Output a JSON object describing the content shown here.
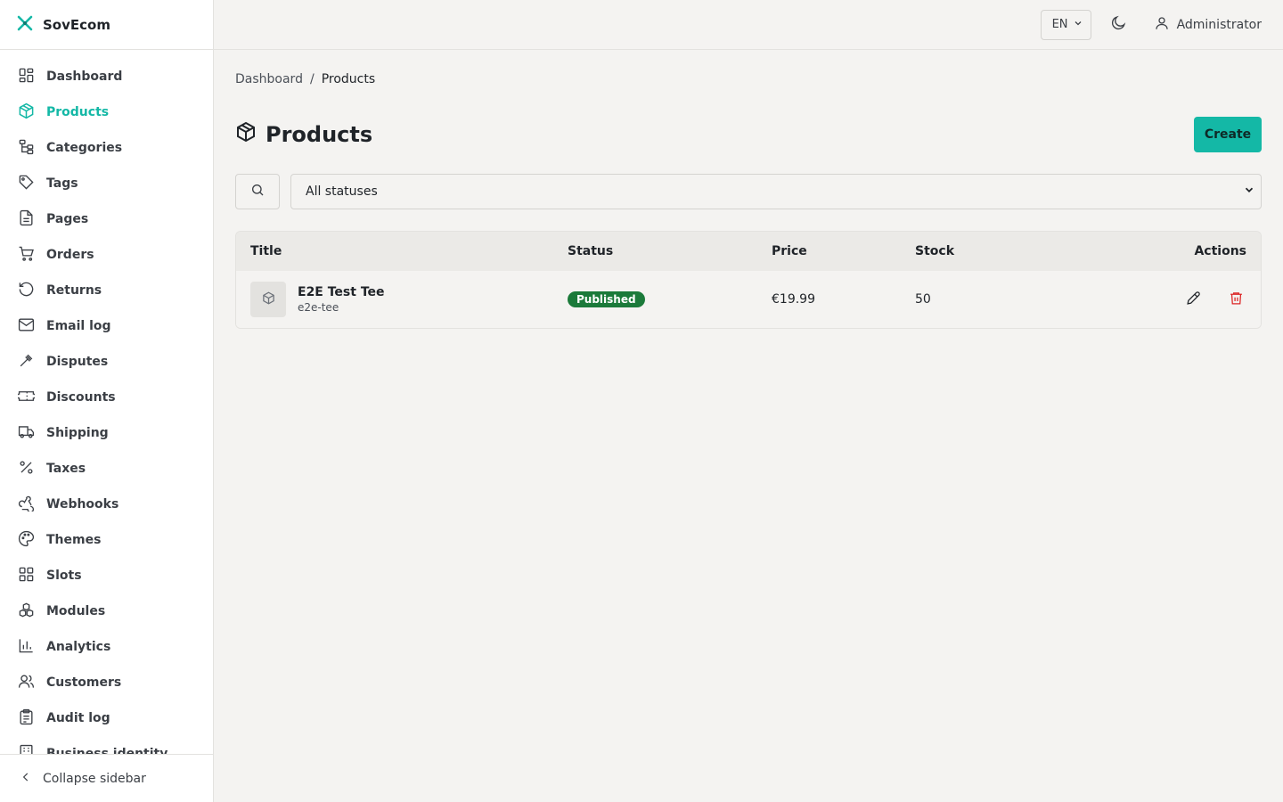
{
  "brand": {
    "name": "SovEcom",
    "accent": "#14b8a6"
  },
  "sidebar": {
    "items": [
      {
        "label": "Dashboard",
        "icon": "dashboard-icon"
      },
      {
        "label": "Products",
        "icon": "package-icon",
        "active": true
      },
      {
        "label": "Categories",
        "icon": "categories-icon"
      },
      {
        "label": "Tags",
        "icon": "tag-icon"
      },
      {
        "label": "Pages",
        "icon": "page-icon"
      },
      {
        "label": "Orders",
        "icon": "cart-icon"
      },
      {
        "label": "Returns",
        "icon": "returns-icon"
      },
      {
        "label": "Email log",
        "icon": "mail-icon"
      },
      {
        "label": "Disputes",
        "icon": "gavel-icon"
      },
      {
        "label": "Discounts",
        "icon": "ticket-icon"
      },
      {
        "label": "Shipping",
        "icon": "truck-icon"
      },
      {
        "label": "Taxes",
        "icon": "percent-icon"
      },
      {
        "label": "Webhooks",
        "icon": "webhook-icon"
      },
      {
        "label": "Themes",
        "icon": "palette-icon"
      },
      {
        "label": "Slots",
        "icon": "slots-icon"
      },
      {
        "label": "Modules",
        "icon": "boxes-icon"
      },
      {
        "label": "Analytics",
        "icon": "chart-icon"
      },
      {
        "label": "Customers",
        "icon": "users-icon"
      },
      {
        "label": "Audit log",
        "icon": "clipboard-icon"
      },
      {
        "label": "Business identity",
        "icon": "building-icon"
      }
    ],
    "collapse_label": "Collapse sidebar"
  },
  "topbar": {
    "language": "EN",
    "user": "Administrator"
  },
  "breadcrumb": {
    "root": "Dashboard",
    "separator": "/",
    "current": "Products"
  },
  "page": {
    "title": "Products",
    "create_label": "Create"
  },
  "filters": {
    "status_value": "All statuses"
  },
  "table": {
    "headers": {
      "title": "Title",
      "status": "Status",
      "price": "Price",
      "stock": "Stock",
      "actions": "Actions"
    },
    "rows": [
      {
        "title": "E2E Test Tee",
        "slug": "e2e-tee",
        "status": "Published",
        "price": "€19.99",
        "stock": "50"
      }
    ]
  },
  "colors": {
    "published_badge": "#1b7a3a",
    "delete_icon": "#dc2626"
  }
}
